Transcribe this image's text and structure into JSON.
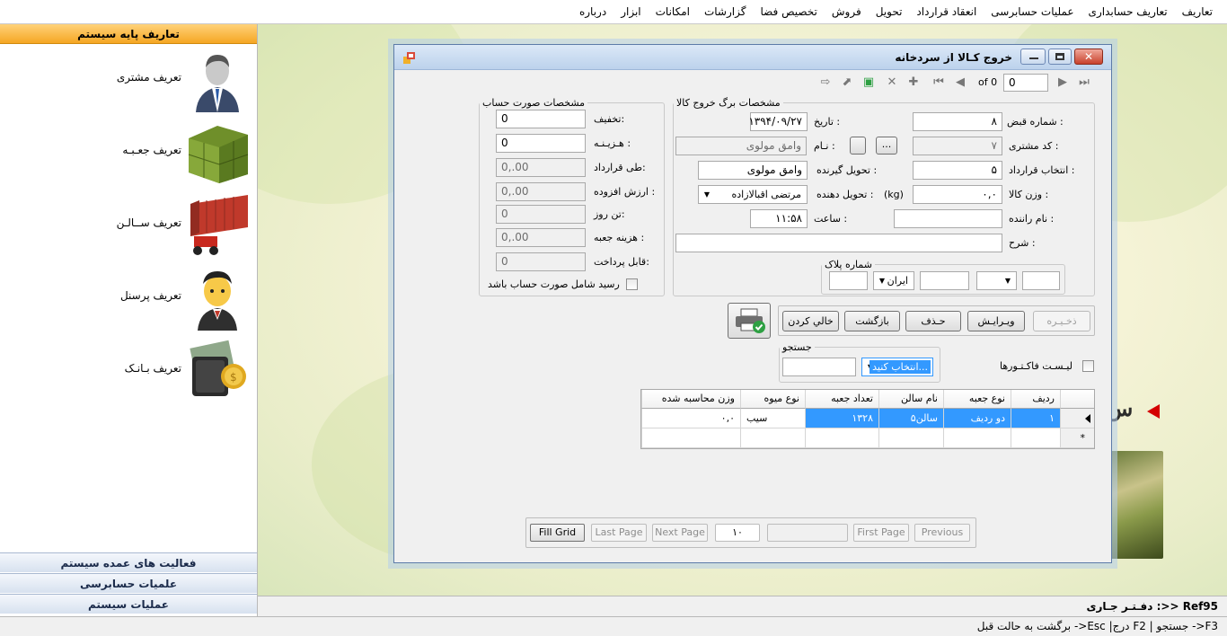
{
  "menu": [
    "تعاریف",
    "تعاریف حسابداری",
    "عملیات حسابرسی",
    "انعقاد قرارداد",
    "تحویل",
    "فروش",
    "تخصیص فضا",
    "گزارشات",
    "امکانات",
    "ابزار",
    "درباره"
  ],
  "left_panel": {
    "header": "تعاریف پایه سیستم",
    "items": [
      "تعریف مشتری",
      "تعریف جعـبـه",
      "تعریف ســالـن",
      "تعریف پرسنل",
      "تعریف بـانـک"
    ],
    "footer": [
      "فعالیت های عمده سیستم",
      "علمیات حسابرسی",
      "عملیات سیستم"
    ]
  },
  "background": {
    "text": "س"
  },
  "dialog": {
    "title": "خروج کـالا از سردخانه",
    "navigator": {
      "position": "0",
      "of_label": "of 0"
    },
    "section_main": {
      "legend": "مشخصات برگ خروج کالا",
      "receipt_no_label": "شماره قبض :",
      "receipt_no": "۸",
      "date_label": "تاریخ :",
      "date": "۱۳۹۴/۰۹/۲۷",
      "customer_code_label": "کد مشتری :",
      "customer_code": "۷",
      "name_label": "نـام :",
      "name": "وامق مولوی",
      "browse_label": "...",
      "contract_label": "انتخاب  قرارداد :",
      "contract": "۵",
      "receiver_label": "تحویل گیرنده :",
      "receiver": "وامق مولوی",
      "weight_label": "وزن کالا :",
      "weight": "۰,۰",
      "kg_label": "(kg)",
      "deliverer_label": "تحویل دهنده :",
      "deliverer": "مرتضی  اقبالازاده",
      "driver_label": "نام راننده :",
      "driver": "",
      "time_label": "ساعت :",
      "time": "۱۱:۵۸",
      "desc_label": "شرح :",
      "desc": "",
      "plate": {
        "legend": "شماره پلاک",
        "country": "ایران"
      }
    },
    "section_invoice": {
      "legend": "مشخصات صورت حساب",
      "discount_label": "تخفیف:",
      "discount": "0",
      "cost_label": "هـزیـنـه :",
      "cost": "0",
      "contract_label": "طی قرارداد:",
      "contract": "0,.00",
      "vat_label": "ارزش افزوده :",
      "vat": "0,.00",
      "ton_day_label": "تن روز:",
      "ton_day": "0",
      "box_cost_label": "هزینه جعبه :",
      "box_cost": "0,.00",
      "payable_label": "قابل پرداخت:",
      "payable": "0",
      "include_invoice_label": "رسید شامل صورت حساب باشد"
    },
    "buttons": {
      "save": "ذخـیـره",
      "edit": "ویـرایـش",
      "delete": "حـذف",
      "back": "بازگشت",
      "clear": "خالي كردن"
    },
    "invoice_list_label": "لیـسـت فاکـتـورها",
    "search": {
      "legend": "جستجو",
      "select": "انتخاب کنید...",
      "text": ""
    },
    "grid": {
      "columns": [
        "ردیف",
        "نوع جعبه",
        "نام سالن",
        "تعداد جعبه",
        "نوع میوه",
        "وزن محاسبه شده"
      ],
      "rows": [
        [
          "۱",
          "دو ردیف",
          "سالن۵",
          "۱۳۲۸",
          "سیب",
          "۰,۰"
        ]
      ],
      "new_row_marker": "*"
    },
    "paging": {
      "fill_grid": "Fill Grid",
      "last_page": "Last Page",
      "next_page": "Next Page",
      "page_size": "۱۰",
      "first_page": "First Page",
      "previous": "Previous"
    }
  },
  "status": {
    "office": "دفـتـر جـاری :>> Ref95",
    "hints": "برگشت به حالت قبل ->Esc |درج F2 | جستجو ->F3"
  }
}
